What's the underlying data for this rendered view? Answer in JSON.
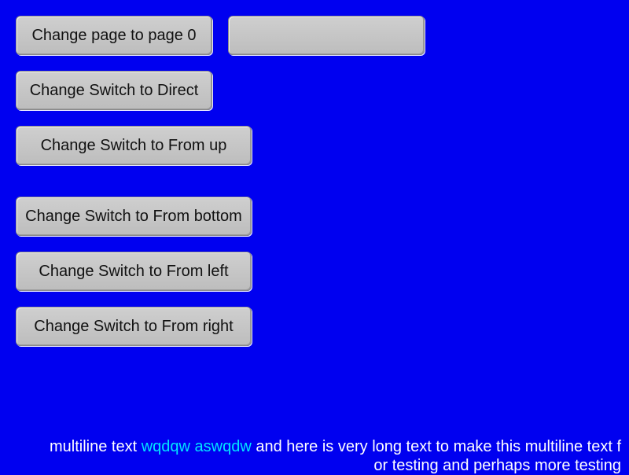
{
  "colors": {
    "background": "#0000f0",
    "button_face": "#c8c8c8",
    "button_text": "#111111",
    "text": "#ffffff",
    "highlight_text": "#00e5ff"
  },
  "buttons": {
    "change_page": "Change page to page 0",
    "empty": "",
    "switch_direct": "Change Switch to Direct",
    "switch_from_up": "Change Switch to From up",
    "switch_from_bottom": "Change Switch to From bottom",
    "switch_from_left": "Change Switch to From left",
    "switch_from_right": "Change Switch to From right"
  },
  "multiline": {
    "line1_start": "multiline text ",
    "line1_highlight": "wqdqw aswqdw",
    "line1_end": " and here is very long text to make this multiline text f",
    "line2": "or testing and perhaps more testing"
  }
}
